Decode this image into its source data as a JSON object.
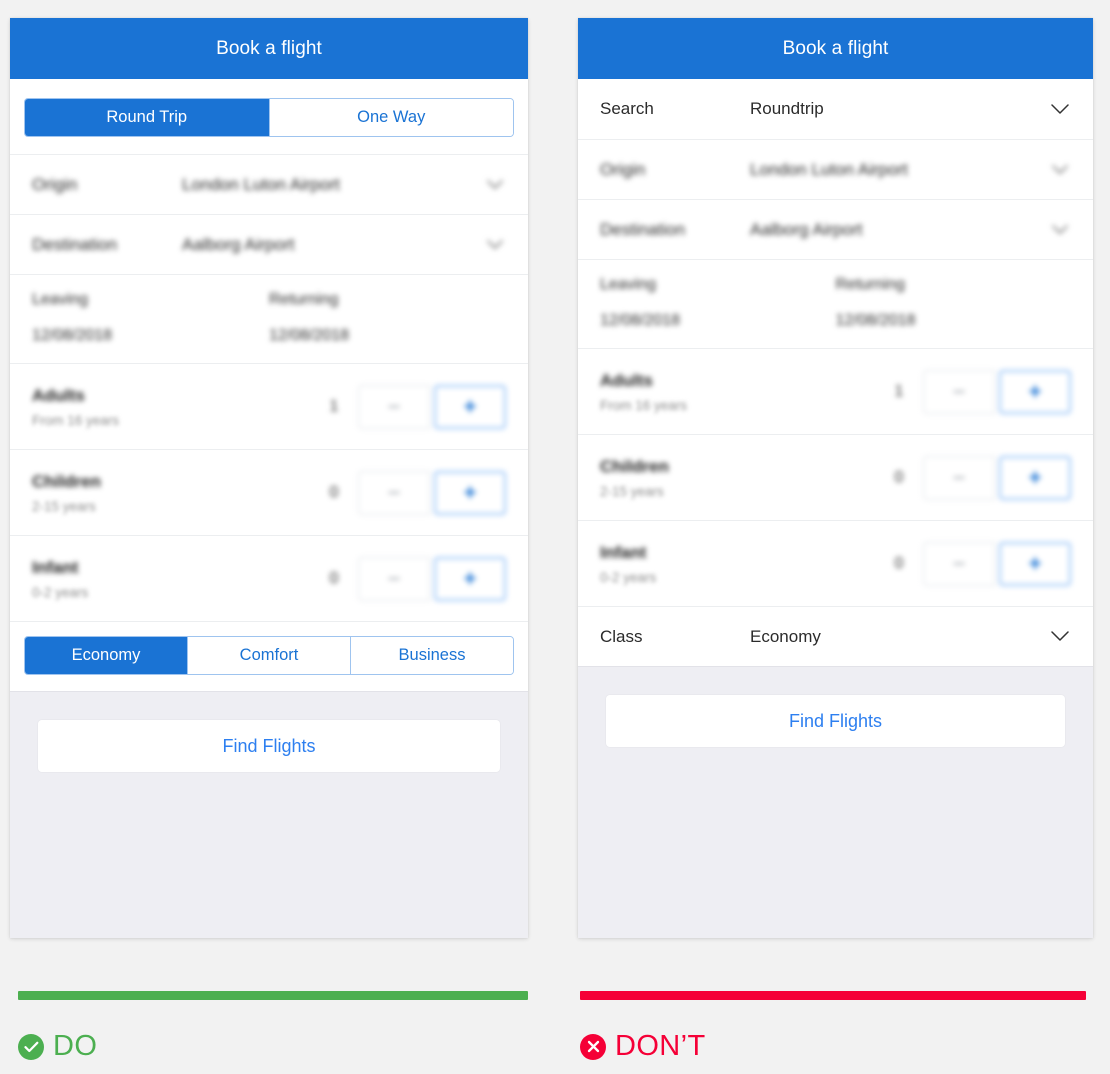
{
  "page": {
    "background": "#f2f2f2",
    "accent_blue": "#1a73d4",
    "link_blue": "#2d7ff0",
    "do_green": "#4caf50",
    "dont_red": "#f50037"
  },
  "do_card": {
    "header_title": "Book a flight",
    "trip_tabs": [
      {
        "label": "Round Trip",
        "active": true
      },
      {
        "label": "One Way",
        "active": false
      }
    ],
    "origin": {
      "label": "Origin",
      "value": "London Luton Airport",
      "icon": "chevron-down-icon"
    },
    "destination": {
      "label": "Destination",
      "value": "Aalborg Airport",
      "icon": "chevron-down-icon"
    },
    "dates": {
      "leaving_label": "Leaving",
      "leaving_value": "12/08/2018",
      "returning_label": "Returning",
      "returning_value": "12/08/2018"
    },
    "passengers": [
      {
        "title": "Adults",
        "subtitle": "From 16 years",
        "count": "1",
        "minus": "−",
        "plus": "+"
      },
      {
        "title": "Children",
        "subtitle": "2-15 years",
        "count": "0",
        "minus": "−",
        "plus": "+"
      },
      {
        "title": "Infant",
        "subtitle": "0-2 years",
        "count": "0",
        "minus": "−",
        "plus": "+"
      }
    ],
    "class_tabs": [
      {
        "label": "Economy",
        "active": true
      },
      {
        "label": "Comfort",
        "active": false
      },
      {
        "label": "Business",
        "active": false
      }
    ],
    "cta_label": "Find Flights"
  },
  "dont_card": {
    "header_title": "Book a flight",
    "search": {
      "label": "Search",
      "value": "Roundtrip",
      "icon": "chevron-down-icon"
    },
    "origin": {
      "label": "Origin",
      "value": "London Luton Airport",
      "icon": "chevron-down-icon"
    },
    "destination": {
      "label": "Destination",
      "value": "Aalborg Airport",
      "icon": "chevron-down-icon"
    },
    "dates": {
      "leaving_label": "Leaving",
      "leaving_value": "12/08/2018",
      "returning_label": "Returning",
      "returning_value": "12/08/2018"
    },
    "passengers": [
      {
        "title": "Adults",
        "subtitle": "From 16 years",
        "count": "1",
        "minus": "−",
        "plus": "+"
      },
      {
        "title": "Children",
        "subtitle": "2-15 years",
        "count": "0",
        "minus": "−",
        "plus": "+"
      },
      {
        "title": "Infant",
        "subtitle": "0-2 years",
        "count": "0",
        "minus": "−",
        "plus": "+"
      }
    ],
    "class_row": {
      "label": "Class",
      "value": "Economy",
      "icon": "chevron-down-icon"
    },
    "cta_label": "Find Flights"
  },
  "captions": {
    "do": {
      "text": "DO",
      "icon": "check-circle-icon"
    },
    "dont": {
      "text": "DON’T",
      "icon": "x-circle-icon"
    }
  }
}
